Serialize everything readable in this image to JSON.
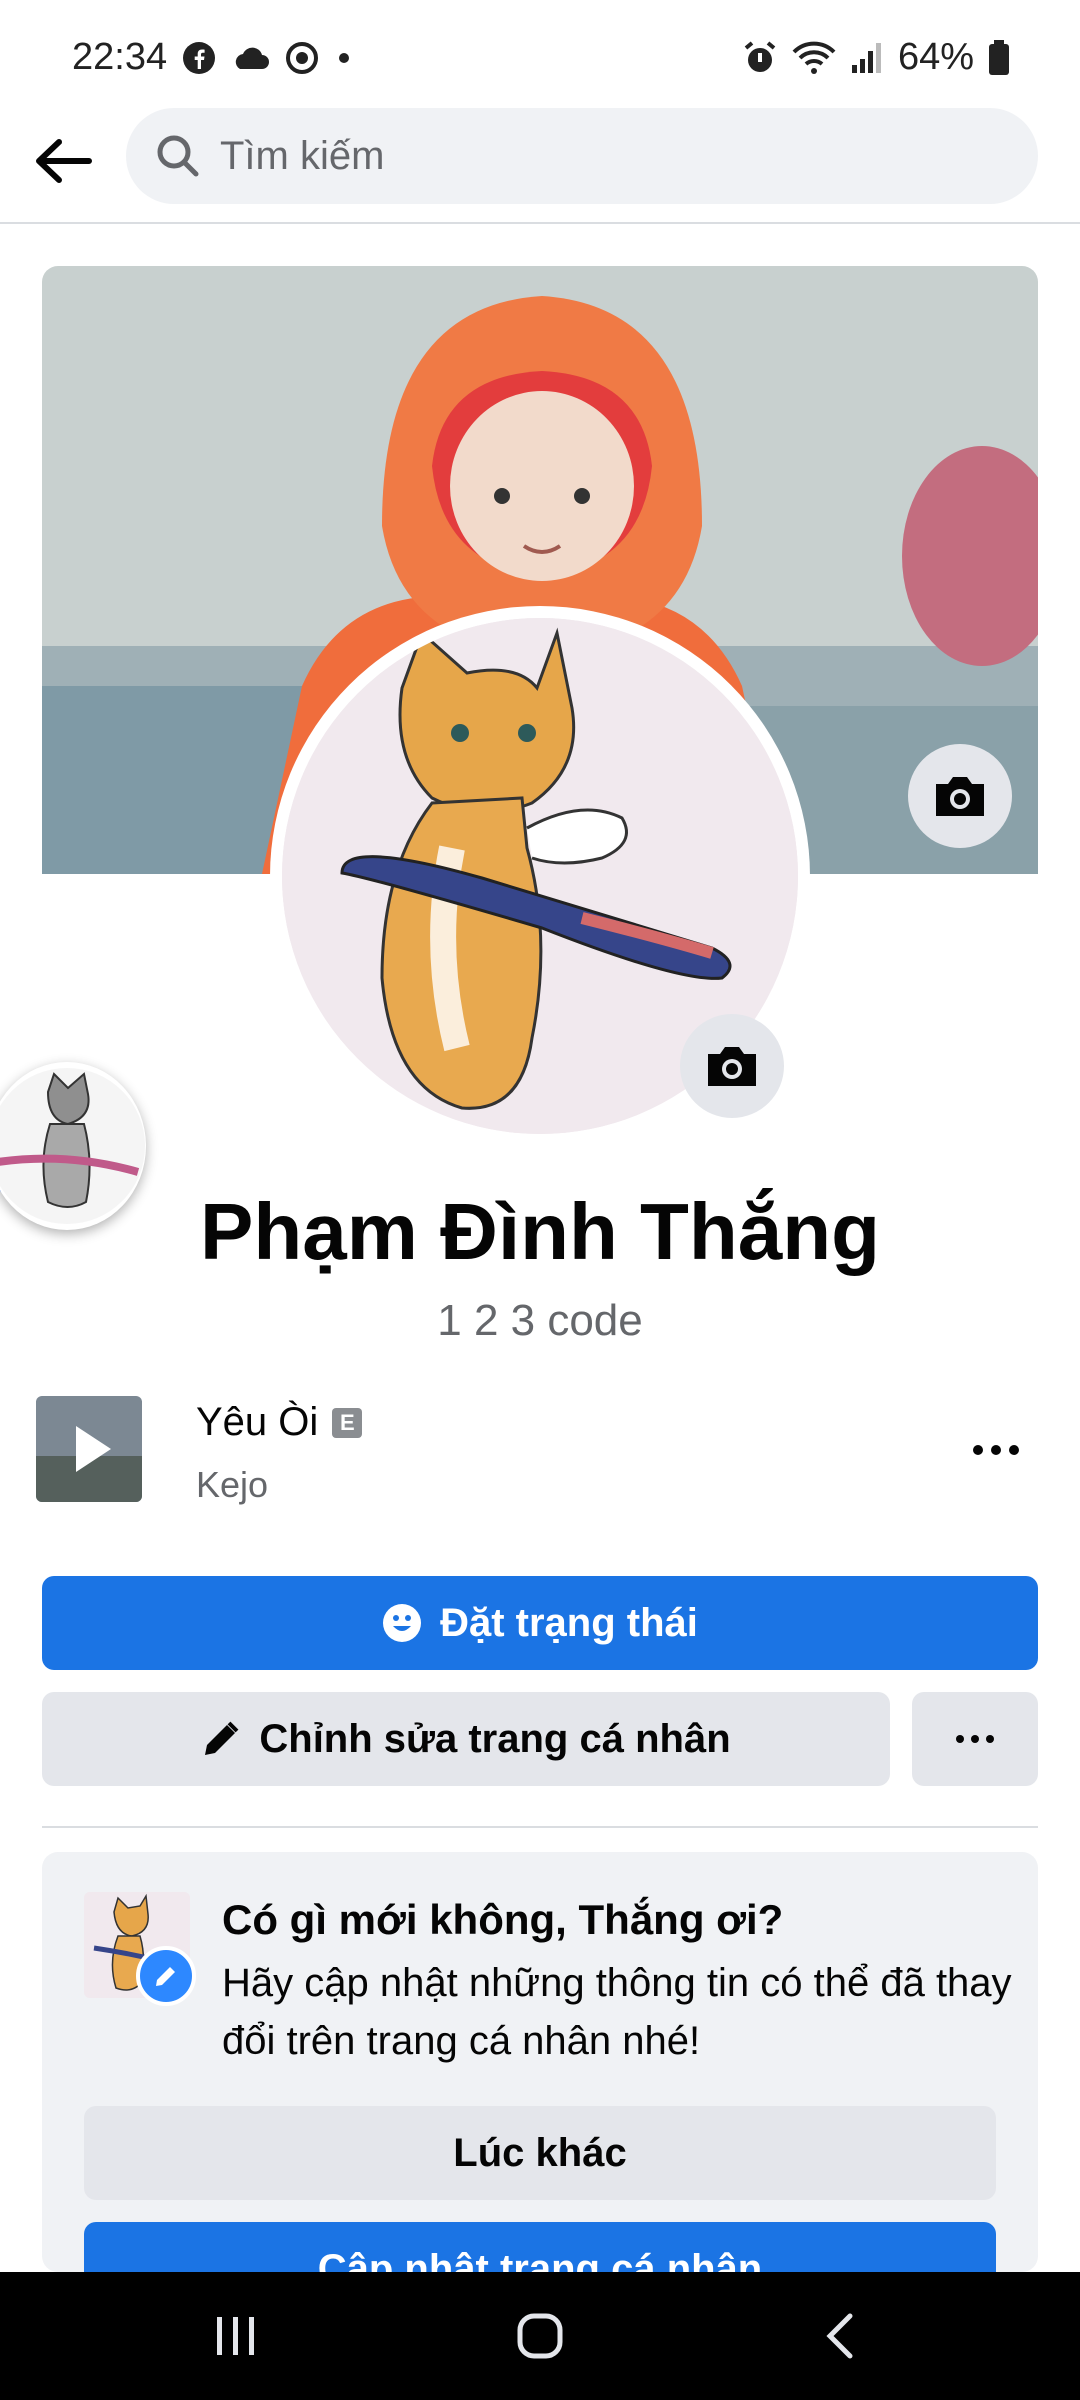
{
  "status_bar": {
    "time": "22:34",
    "battery": "64%",
    "icons": [
      "facebook-icon",
      "cloud-icon",
      "sync-icon",
      "dot-icon",
      "alarm-icon",
      "wifi-icon",
      "signal-icon",
      "battery-icon"
    ]
  },
  "header": {
    "search_placeholder": "Tìm kiếm"
  },
  "profile": {
    "name": "Phạm Đình Thắng",
    "bio": "1 2 3 code"
  },
  "music": {
    "title": "Yêu Òi",
    "explicit_badge": "E",
    "artist": "Kejo"
  },
  "actions": {
    "set_status_label": "Đặt trạng thái",
    "edit_profile_label": "Chỉnh sửa trang cá nhân"
  },
  "prompt_card": {
    "title": "Có gì mới không, Thắng ơi?",
    "text": "Hãy cập nhật những thông tin có thể đã thay đổi trên trang cá nhân nhé!",
    "later_label": "Lúc khác",
    "update_label": "Cập nhật trang cá nhân"
  },
  "colors": {
    "brand_blue": "#1b74e4",
    "secondary_gray": "#e4e6eb",
    "text_secondary": "#65676b"
  }
}
